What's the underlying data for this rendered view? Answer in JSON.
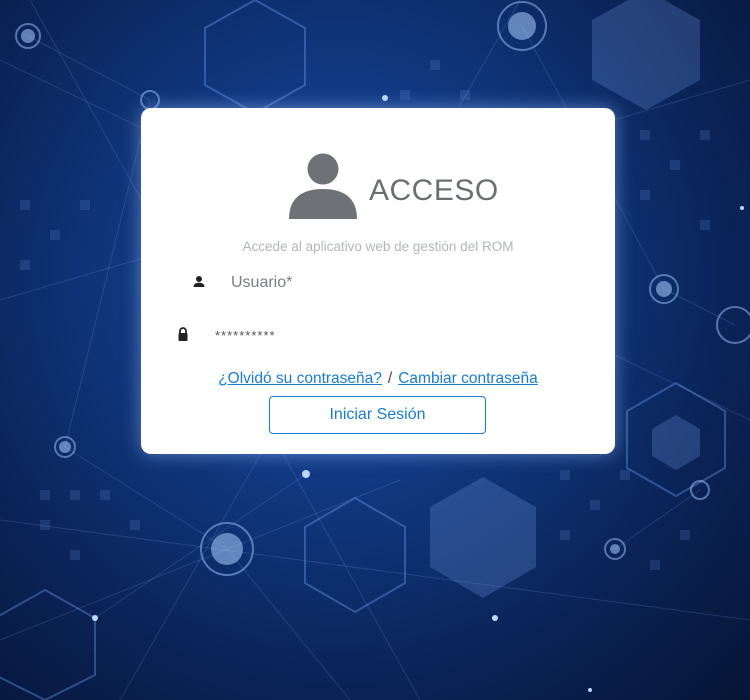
{
  "login": {
    "title": "ACCESO",
    "subtitle": "Accede al aplicativo web de gestión del ROM",
    "avatar_icon": "user-avatar-icon",
    "username": {
      "placeholder": "Usuario*",
      "value": "",
      "icon": "person-icon"
    },
    "password": {
      "value": "**********",
      "icon": "lock-icon"
    },
    "forgot_password_label": "¿Olvidó su contraseña?",
    "separator": "/",
    "change_password_label": "Cambiar contraseña",
    "submit_label": "Iniciar Sesión"
  },
  "colors": {
    "accent": "#1a7cd0",
    "background": "#0f357a",
    "card": "#ffffff",
    "title": "#6b6f73",
    "subtitle": "#b2b6ba"
  }
}
